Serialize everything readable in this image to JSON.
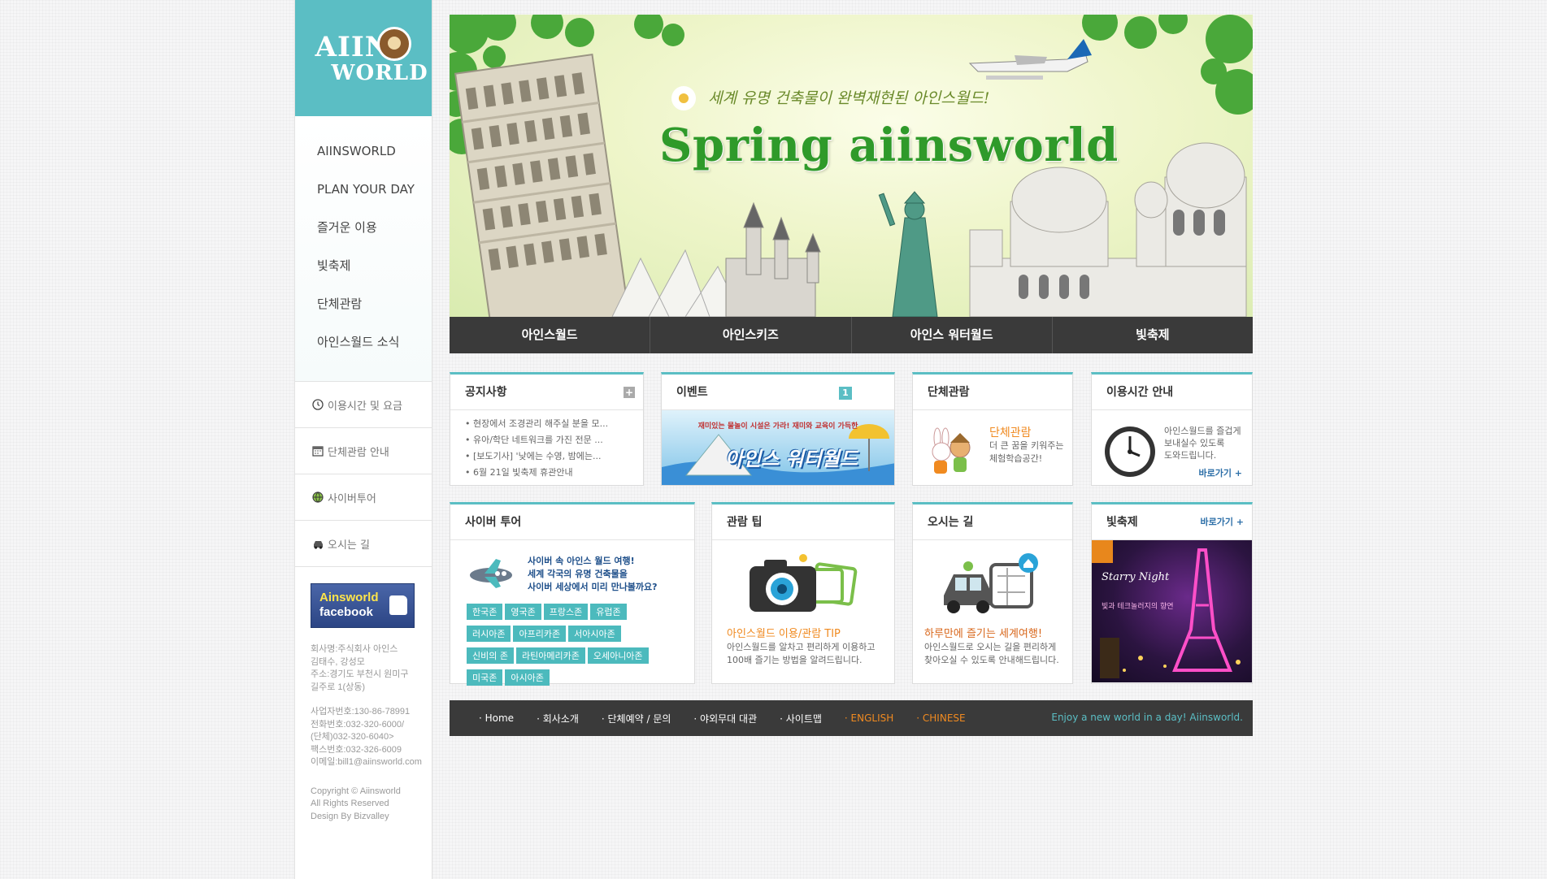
{
  "logo": {
    "line1": "AIINS",
    "line2": "WORLD"
  },
  "sidebar": {
    "main_nav": [
      "AIINSWORLD",
      "PLAN YOUR DAY",
      "즐거운 이용",
      "빛축제",
      "단체관람",
      "아인스월드 소식"
    ],
    "sub_nav": [
      {
        "label": "이용시간 및 요금",
        "icon": "clock-icon"
      },
      {
        "label": "단체관람 안내",
        "icon": "calendar-icon"
      },
      {
        "label": "사이버투어",
        "icon": "globe-icon"
      },
      {
        "label": "오시는 길",
        "icon": "car-icon"
      }
    ],
    "facebook": {
      "line1": "Ainsworld",
      "line2": "facebook"
    },
    "company_info": [
      "회사명:주식회사 아인스",
      "김태수, 강성모",
      "주소:경기도 부천시 원미구",
      "길주로 1(상동)",
      "사업자번호:130-86-78991",
      "전화번호:032-320-6000/",
      "(단체)032-320-6040>",
      "팩스번호:032-326-6009",
      "이메일:bill1@aiinsworld.com",
      "Copyright © Aiinsworld",
      "All Rights Reserved",
      "Design By Bizvalley"
    ]
  },
  "banner": {
    "subtitle": "세계 유명 건축물이 완벽재현된 아인스월드!",
    "title": "Spring aiinsworld"
  },
  "tabs": [
    "아인스월드",
    "아인스키즈",
    "아인스 워터월드",
    "빛축제"
  ],
  "notice": {
    "title": "공지사항",
    "items": [
      "현장에서 조경관리 해주실 분을 모...",
      "유아/학단 네트워크를 가진 전문 ...",
      "[보도기사] '낮에는 수영, 밤에는...",
      "6월 21일 빛축제 휴관안내"
    ]
  },
  "event": {
    "title": "이벤트",
    "badge": "1",
    "banner_text": "재미있는 물놀이 시설은 가라! 재미와 교육이 가득한",
    "banner_title": "아인스 워터월드"
  },
  "group": {
    "title": "단체관람",
    "promo_title": "단체관람",
    "promo_desc": [
      "더 큰 꿈을 키워주는",
      "체험학습공간!"
    ]
  },
  "hours": {
    "title": "이용시간 안내",
    "desc": [
      "아인스월드를 즐겁게",
      "보내실수 있도록",
      "도와드립니다."
    ],
    "link": "바로가기 +"
  },
  "cyber": {
    "title": "사이버 투어",
    "desc": [
      "사이버 속 아인스 월드 여행!",
      "세계 각국의 유명 건축물을",
      "사이버 세상에서 미리 만나볼까요?"
    ],
    "tags": [
      "한국존",
      "영국존",
      "프랑스존",
      "유럽존",
      "러시아존",
      "아프리카존",
      "서아시아존",
      "신비의 존",
      "라틴아메리카존",
      "오세아니아존",
      "미국존",
      "아시아존"
    ]
  },
  "tip": {
    "title": "관람 팁",
    "promo_title": "아인스월드 이용/관람 TIP",
    "desc": [
      "아인스월드를 알차고 편리하게 이용하고",
      "100배 즐기는 방법을 알려드립니다."
    ]
  },
  "directions": {
    "title": "오시는 길",
    "promo_title": "하루만에 즐기는 세계여행!",
    "desc": [
      "아인스월드로 오시는 길을 편리하게",
      "찾아오실 수 있도록 안내해드립니다."
    ]
  },
  "light": {
    "title": "빛축제",
    "link": "바로가기 +",
    "img_text1": "Starry Night",
    "img_text2": "빛과 테크놀러지의 향연"
  },
  "footer": {
    "links": [
      "· Home",
      "· 회사소개",
      "· 단체예약 / 문의",
      "· 야외무대 대관",
      "· 사이트맵"
    ],
    "lang": [
      "· ENGLISH",
      "· CHINESE"
    ],
    "slogan": "Enjoy a new world in a day! Aiinsworld."
  },
  "colors": {
    "accent": "#5bbec4",
    "dark": "#3a3a3a",
    "orange": "#f08a20",
    "tag": "#4cbabd"
  }
}
